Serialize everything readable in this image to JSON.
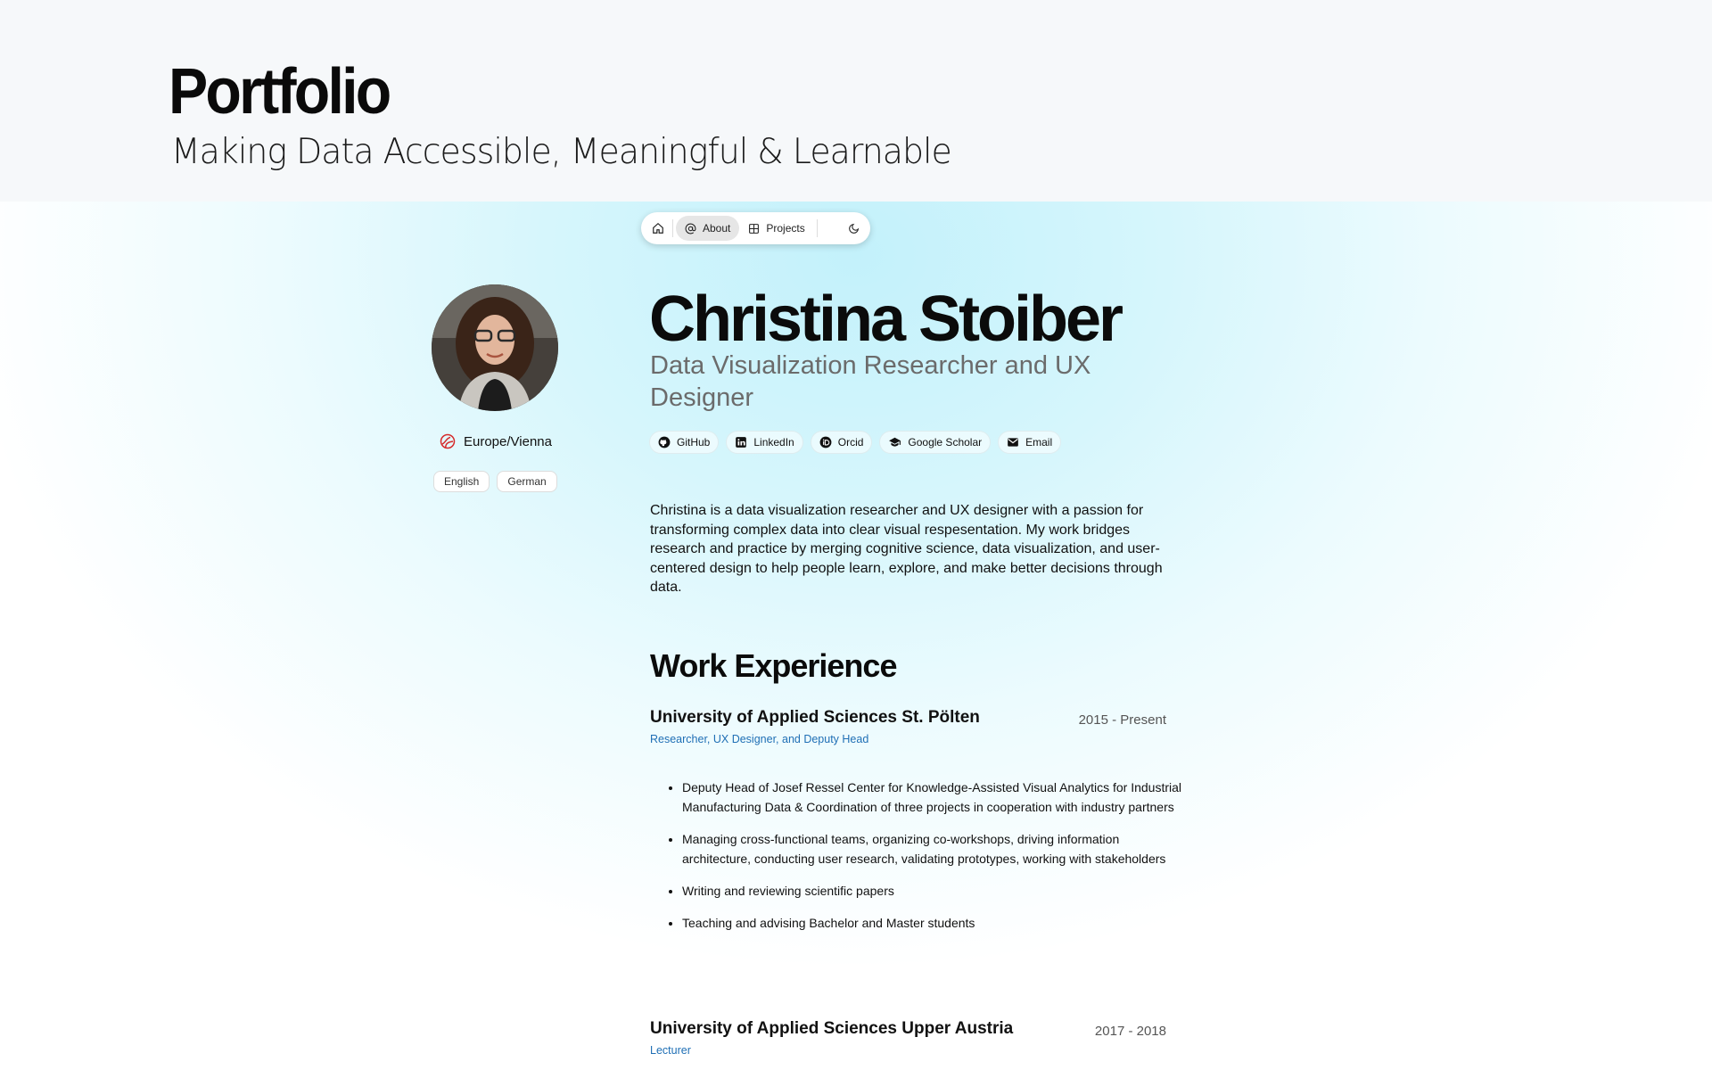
{
  "banner": {
    "title": "Portfolio",
    "subtitle": "Making Data Accessible, Meaningful & Learnable"
  },
  "nav": {
    "home_icon": "home-icon",
    "items": [
      {
        "label": "About",
        "icon": "at-icon",
        "active": true
      },
      {
        "label": "Projects",
        "icon": "grid-icon",
        "active": false
      }
    ],
    "theme_icon": "moon-icon"
  },
  "profile": {
    "name": "Christina Stoiber",
    "role": "Data Visualization Researcher and UX Designer",
    "location": "Europe/Vienna",
    "languages": [
      "English",
      "German"
    ],
    "links": [
      {
        "label": "GitHub",
        "icon": "github-icon"
      },
      {
        "label": "LinkedIn",
        "icon": "linkedin-icon"
      },
      {
        "label": "Orcid",
        "icon": "orcid-icon"
      },
      {
        "label": "Google Scholar",
        "icon": "graduation-cap-icon"
      },
      {
        "label": "Email",
        "icon": "mail-icon"
      }
    ],
    "bio": "Christina is a data visualization researcher and UX designer with a passion for transforming complex data into clear visual respesentation. My work bridges research and practice by merging cognitive science, data visualization, and user-centered design to help people learn, explore, and make better decisions through data."
  },
  "work": {
    "title": "Work Experience",
    "jobs": [
      {
        "org": "University of Applied Sciences St. Pölten",
        "role": "Researcher, UX Designer, and Deputy Head",
        "period": "2015 - Present",
        "duties": [
          "Deputy Head of Josef Ressel Center for Knowledge-Assisted Visual Analytics for Industrial Manufacturing Data & Coordination of three projects in cooperation with industry partners",
          "Managing cross-functional teams, organizing co-workshops, driving information architecture, conducting user research, validating prototypes, working with stakeholders",
          "Writing and reviewing scientific papers",
          "Teaching and advising Bachelor and Master students"
        ]
      },
      {
        "org": "University of Applied Sciences Upper Austria",
        "role": "Lecturer",
        "period": "2017 - 2018"
      }
    ]
  },
  "colors": {
    "accent_link": "#1f6fb5",
    "gradient": "#c3f1fb",
    "banner_bg": "#f6f8fa"
  }
}
